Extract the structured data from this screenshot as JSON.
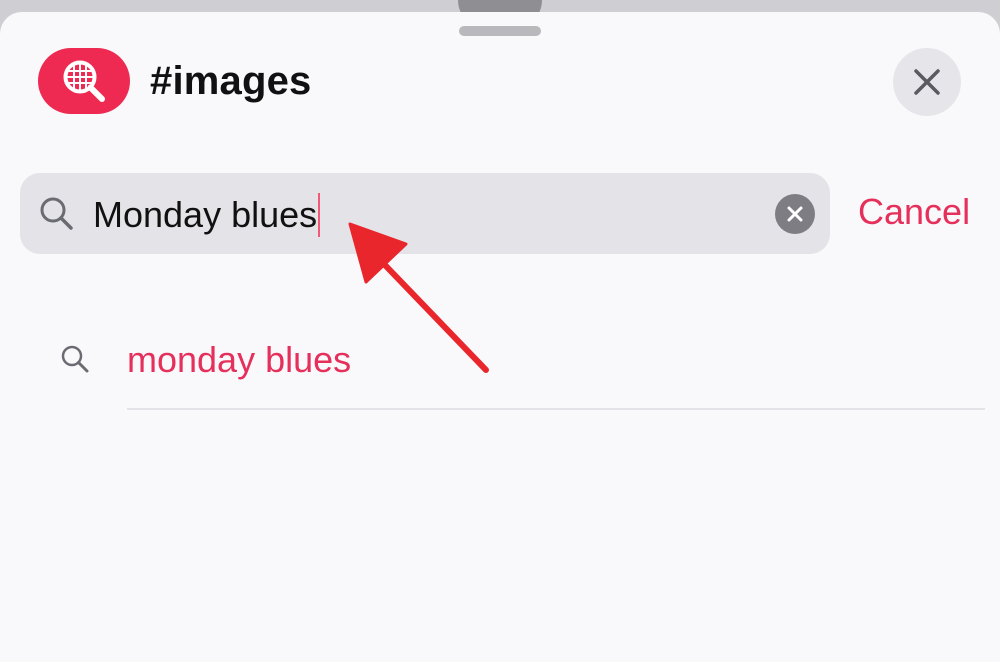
{
  "sheet": {
    "title": "#images",
    "app_icon": "image-search-icon",
    "close_icon": "close-icon",
    "accent_color": "#e6305c",
    "icon_background": "#ee2a52"
  },
  "search": {
    "value": "Monday blues",
    "search_icon": "search-icon",
    "clear_icon": "clear-circle-icon",
    "cancel_label": "Cancel"
  },
  "suggestions": [
    {
      "label": "monday blues",
      "icon": "search-icon"
    }
  ],
  "annotation": {
    "type": "arrow",
    "color": "#e8262b",
    "points_to": "text-cursor"
  }
}
